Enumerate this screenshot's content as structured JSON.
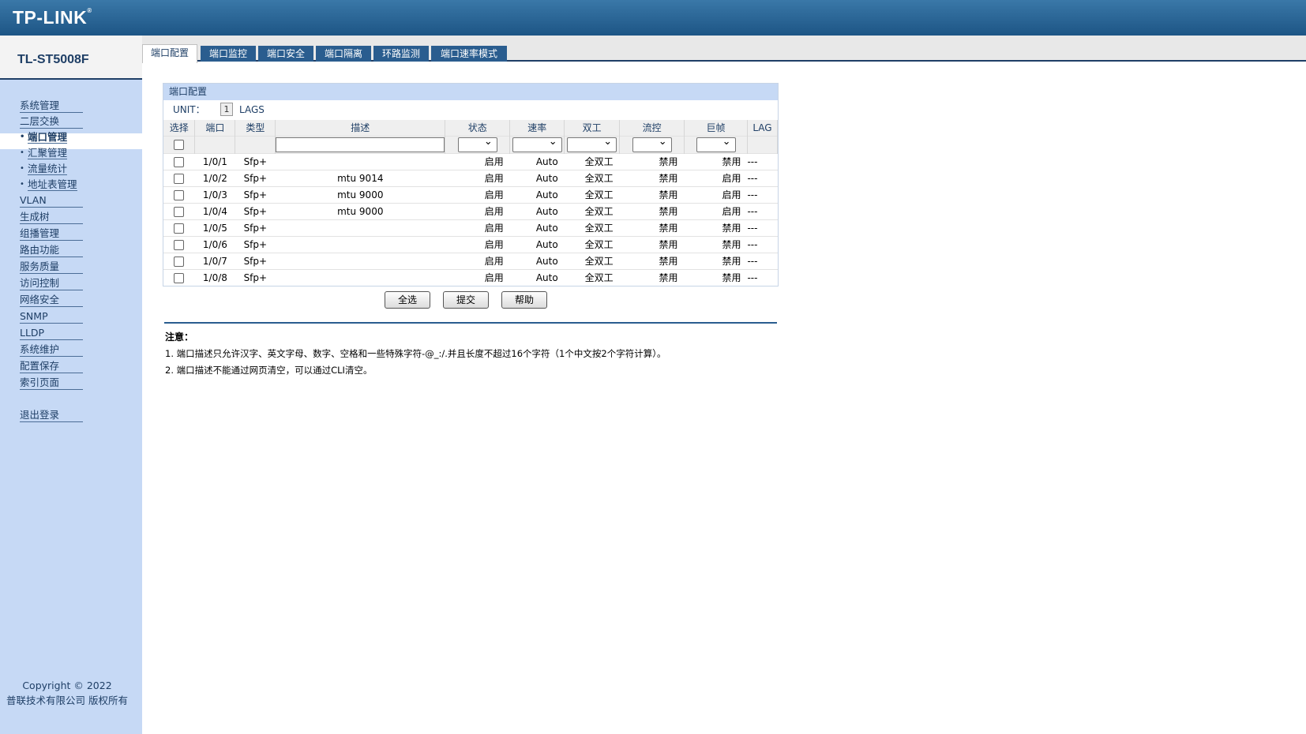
{
  "header": {
    "logo": "TP-LINK",
    "logo_mark": "®"
  },
  "sidebar": {
    "model": "TL-ST5008F",
    "items": [
      {
        "label": "系统管理"
      },
      {
        "label": "二层交换"
      }
    ],
    "subitems": [
      {
        "label": "端口管理",
        "active": true
      },
      {
        "label": "汇聚管理"
      },
      {
        "label": "流量统计"
      },
      {
        "label": "地址表管理"
      }
    ],
    "items2": [
      {
        "label": "VLAN"
      },
      {
        "label": "生成树"
      },
      {
        "label": "组播管理"
      },
      {
        "label": "路由功能"
      },
      {
        "label": "服务质量"
      },
      {
        "label": "访问控制"
      },
      {
        "label": "网络安全"
      },
      {
        "label": "SNMP"
      },
      {
        "label": "LLDP"
      },
      {
        "label": "系统维护"
      },
      {
        "label": "配置保存"
      },
      {
        "label": "索引页面"
      }
    ],
    "logout": "退出登录",
    "copyright_line1": "Copyright © 2022",
    "copyright_line2": "普联技术有限公司 版权所有"
  },
  "tabs": [
    {
      "label": "端口配置",
      "active": true
    },
    {
      "label": "端口监控"
    },
    {
      "label": "端口安全"
    },
    {
      "label": "端口隔离"
    },
    {
      "label": "环路监测"
    },
    {
      "label": "端口速率模式"
    }
  ],
  "panel": {
    "title": "端口配置",
    "unit_label": "UNIT：",
    "unit_value": "1",
    "lags_label": "LAGS"
  },
  "table": {
    "headers": [
      "选择",
      "端口",
      "类型",
      "描述",
      "状态",
      "速率",
      "双工",
      "流控",
      "巨帧",
      "LAG"
    ],
    "rows": [
      [
        "1/0/1",
        "Sfp+",
        "",
        "启用",
        "Auto",
        "全双工",
        "禁用",
        "禁用",
        "---"
      ],
      [
        "1/0/2",
        "Sfp+",
        "mtu 9014",
        "启用",
        "Auto",
        "全双工",
        "禁用",
        "启用",
        "---"
      ],
      [
        "1/0/3",
        "Sfp+",
        "mtu 9000",
        "启用",
        "Auto",
        "全双工",
        "禁用",
        "启用",
        "---"
      ],
      [
        "1/0/4",
        "Sfp+",
        "mtu 9000",
        "启用",
        "Auto",
        "全双工",
        "禁用",
        "启用",
        "---"
      ],
      [
        "1/0/5",
        "Sfp+",
        "",
        "启用",
        "Auto",
        "全双工",
        "禁用",
        "禁用",
        "---"
      ],
      [
        "1/0/6",
        "Sfp+",
        "",
        "启用",
        "Auto",
        "全双工",
        "禁用",
        "禁用",
        "---"
      ],
      [
        "1/0/7",
        "Sfp+",
        "",
        "启用",
        "Auto",
        "全双工",
        "禁用",
        "禁用",
        "---"
      ],
      [
        "1/0/8",
        "Sfp+",
        "",
        "启用",
        "Auto",
        "全双工",
        "禁用",
        "禁用",
        "---"
      ]
    ]
  },
  "buttons": {
    "select_all": "全选",
    "submit": "提交",
    "help": "帮助"
  },
  "notes": {
    "title": "注意：",
    "line1": "1. 端口描述只允许汉字、英文字母、数字、空格和一些特殊字符-@_:/.并且长度不超过16个字符（1个中文按2个字符计算）。",
    "line2": "2. 端口描述不能通过网页清空，可以通过CLI清空。"
  },
  "colors": {
    "header": "#2a5d8f",
    "sidebar": "#c6d9f5",
    "accent": "#1f3f66"
  }
}
